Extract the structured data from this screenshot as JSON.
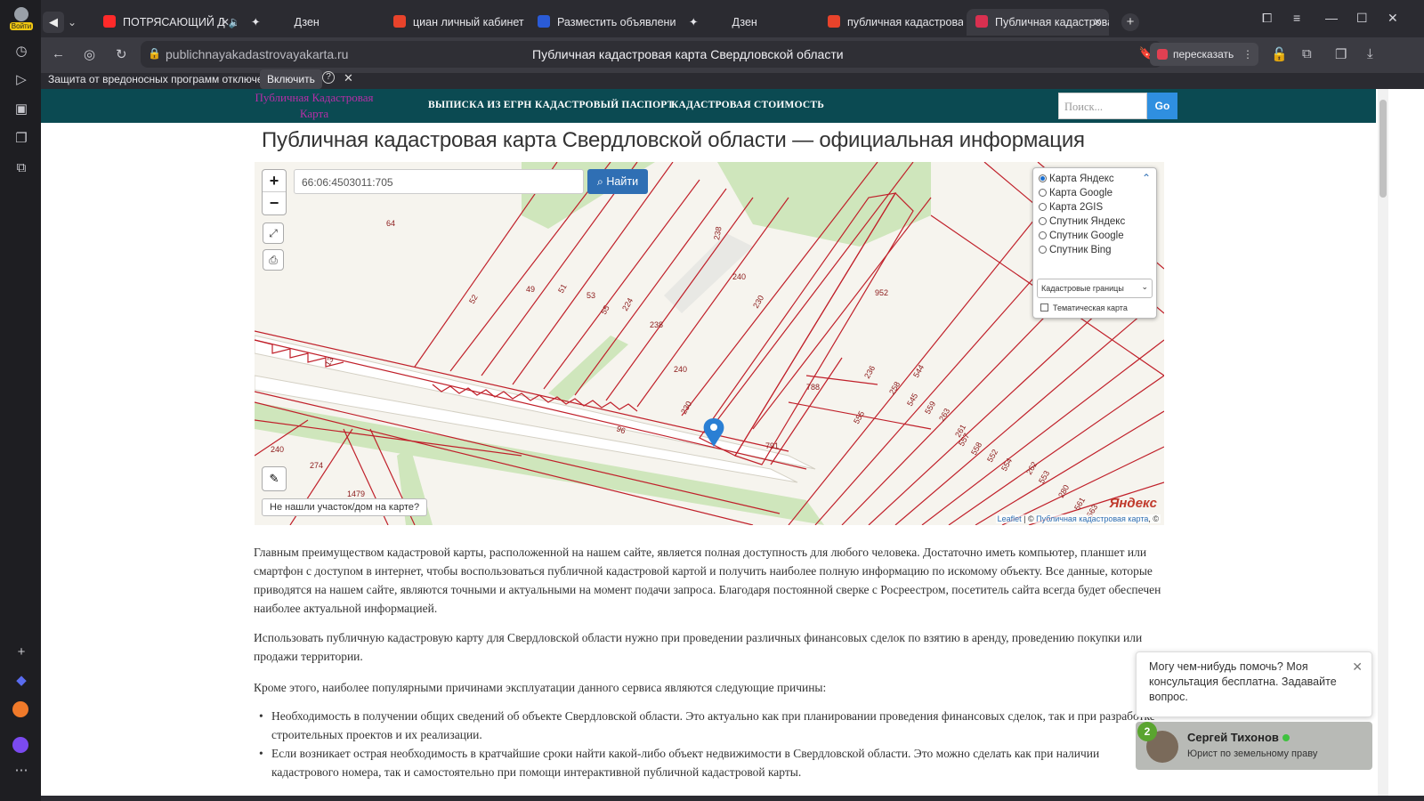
{
  "browser": {
    "tabs": [
      {
        "label": "ПОТРЯСАЮЩИЙ Д",
        "color": "#ff2a2a"
      },
      {
        "label": "Дзен",
        "color": "#2b2b31"
      },
      {
        "label": "циан личный кабинет вой",
        "color": "#e8432b"
      },
      {
        "label": "Разместить объявление с",
        "color": "#2a5bd7"
      },
      {
        "label": "Дзен",
        "color": "#2b2b31"
      },
      {
        "label": "публичная кадастровая к",
        "color": "#e8432b"
      },
      {
        "label": "Публичная кадастрова",
        "color": "#d93050"
      }
    ],
    "login_label": "Войти",
    "url": "publichnayakadastrovayakarta.ru",
    "page_title": "Публичная кадастровая карта Свердловской области",
    "summarize_label": "пересказать",
    "infobar_text": "Защита от вредоносных программ отключена",
    "infobar_button": "Включить"
  },
  "site": {
    "logo": "Публичная Кадастровая Карта",
    "menu": [
      "ВЫПИСКА ИЗ ЕГРН",
      "КАДАСТРОВЫЙ ПАСПОРТ",
      "КАДАСТРОВАЯ СТОИМОСТЬ"
    ],
    "search_placeholder": "Поиск...",
    "go_label": "Go",
    "heading": "Публичная кадастровая карта Свердловской области — официальная информация"
  },
  "map": {
    "search_value": "66:06:4503011:705",
    "find_label": "Найти",
    "layers": [
      "Карта Яндекс",
      "Карта Google",
      "Карта 2GIS",
      "Спутник Яндекс",
      "Спутник Google",
      "Спутник Bing"
    ],
    "selected_layer": "Карта Яндекс",
    "overlay_select": "Кадастровые границы",
    "thematic_label": "Тематическая карта",
    "not_found_label": "Не нашли участок/дом на карте?",
    "attribution_leaflet": "Leaflet",
    "attribution_site": "Публичная кадастровая карта",
    "attribution_sep": "| ©",
    "attribution_tail": ", ©",
    "yandex_logo": "Яндекс",
    "parcel_labels": [
      "64",
      "52",
      "49",
      "51",
      "53",
      "55",
      "224",
      "238",
      "238",
      "240",
      "240",
      "230",
      "952",
      "788",
      "791",
      "236",
      "240",
      "274",
      "1479",
      "13",
      "96",
      "230",
      "555",
      "258",
      "544",
      "545",
      "559",
      "263",
      "261",
      "557",
      "558",
      "552",
      "554",
      "262",
      "553",
      "280",
      "561",
      "563"
    ]
  },
  "content": {
    "p1": "Главным преимуществом кадастровой карты, расположенной на нашем сайте, является полная доступность для любого человека. Достаточно иметь компьютер, планшет или смартфон с доступом в интернет, чтобы воспользоваться публичной кадастровой картой и получить наиболее полную информацию по искомому объекту. Все данные, которые приводятся на нашем сайте, являются точными и актуальными на момент подачи запроса. Благодаря постоянной сверке с Росреестром, посетитель сайта всегда будет обеспечен наиболее актуальной информацией.",
    "p2": "Использовать публичную кадастровую карту для Свердловской области нужно при проведении различных финансовых сделок по взятию в аренду, проведению покупки или продажи территории.",
    "p3": "Кроме этого, наиболее популярными причинами эксплуатации данного сервиса являются следующие причины:",
    "li1": "Необходимость в получении общих сведений об объекте Свердловской области. Это актуально как при планировании проведения финансовых сделок, так и при разработке строительных проектов и их реализации.",
    "li2": "Если возникает острая необходимость в кратчайшие сроки найти какой-либо объект недвижимости в Свердловской области. Это можно сделать как при наличии кадастрового номера, так и самостоятельно при помощи интерактивной публичной кадастровой карты."
  },
  "chat": {
    "message": "Могу чем-нибудь помочь? Моя консультация бесплатна. Задавайте вопрос.",
    "badge": "2",
    "agent_name": "Сергей Тихонов",
    "agent_role": "Юрист по земельному праву"
  }
}
